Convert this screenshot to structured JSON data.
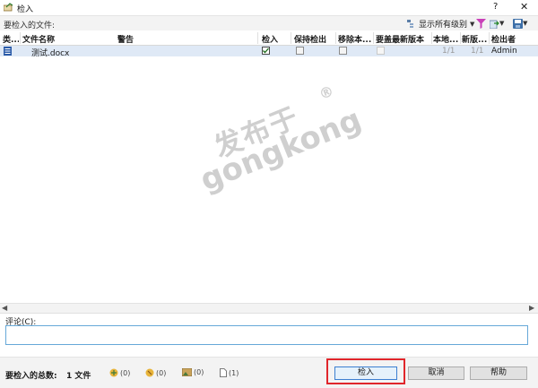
{
  "window": {
    "title": "检入",
    "help_label": "?",
    "close_label": "✕"
  },
  "toolbar": {
    "files_label": "要检入的文件:",
    "show_levels_label": "显示所有级别"
  },
  "columns": [
    "类...",
    "文件名称",
    "警告",
    "检入",
    "保持检出",
    "移除本...",
    "要盖最新版本",
    "本地...",
    "新版...",
    "检出者"
  ],
  "rows": [
    {
      "type_icon": "word-doc-icon",
      "file_name": "测试.docx",
      "warning": "",
      "checkin": true,
      "keep_checked_out": false,
      "remove_local": false,
      "override_latest": false,
      "local_version": "1/1",
      "new_version": "1/1",
      "checked_out_by": "Admin"
    }
  ],
  "watermark": {
    "line1": "发布于",
    "line2": "gongkong",
    "mark": "®"
  },
  "comment": {
    "label": "评论(C):",
    "value": ""
  },
  "summary": {
    "total_label": "要检入的总数:",
    "total_value": "1 文件",
    "stats": [
      {
        "icon": "file-group-icon",
        "value": "(0)"
      },
      {
        "icon": "refresh-files-icon",
        "value": "(0)"
      },
      {
        "icon": "image-file-icon",
        "value": "(0)"
      },
      {
        "icon": "document-icon",
        "value": "(1)"
      }
    ]
  },
  "buttons": {
    "checkin": "检入",
    "cancel": "取消",
    "help": "帮助"
  },
  "colors": {
    "accent": "#3c7fd1",
    "highlight": "#e0262b",
    "selected_row": "#dfe9f6"
  }
}
